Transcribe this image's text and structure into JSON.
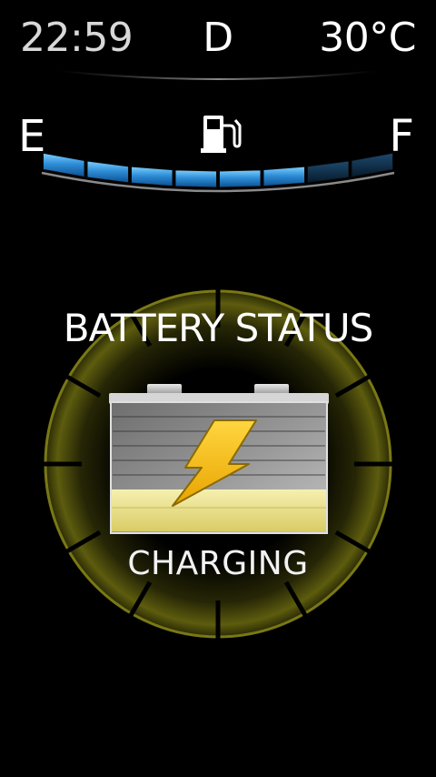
{
  "status_bar": {
    "time": "22:59",
    "gear": "D",
    "temperature": "30°C"
  },
  "fuel_gauge": {
    "empty_label": "E",
    "full_label": "F",
    "icon": "fuel-pump-icon",
    "segments_total": 8,
    "segments_lit": 6,
    "lit_color": "#2f8fd8",
    "unlit_color": "#0e2f48"
  },
  "battery": {
    "title": "BATTERY STATUS",
    "state": "CHARGING",
    "icon": "charging-battery-icon",
    "dial_color": "#6b6a10",
    "bolt_color": "#f0c020"
  }
}
